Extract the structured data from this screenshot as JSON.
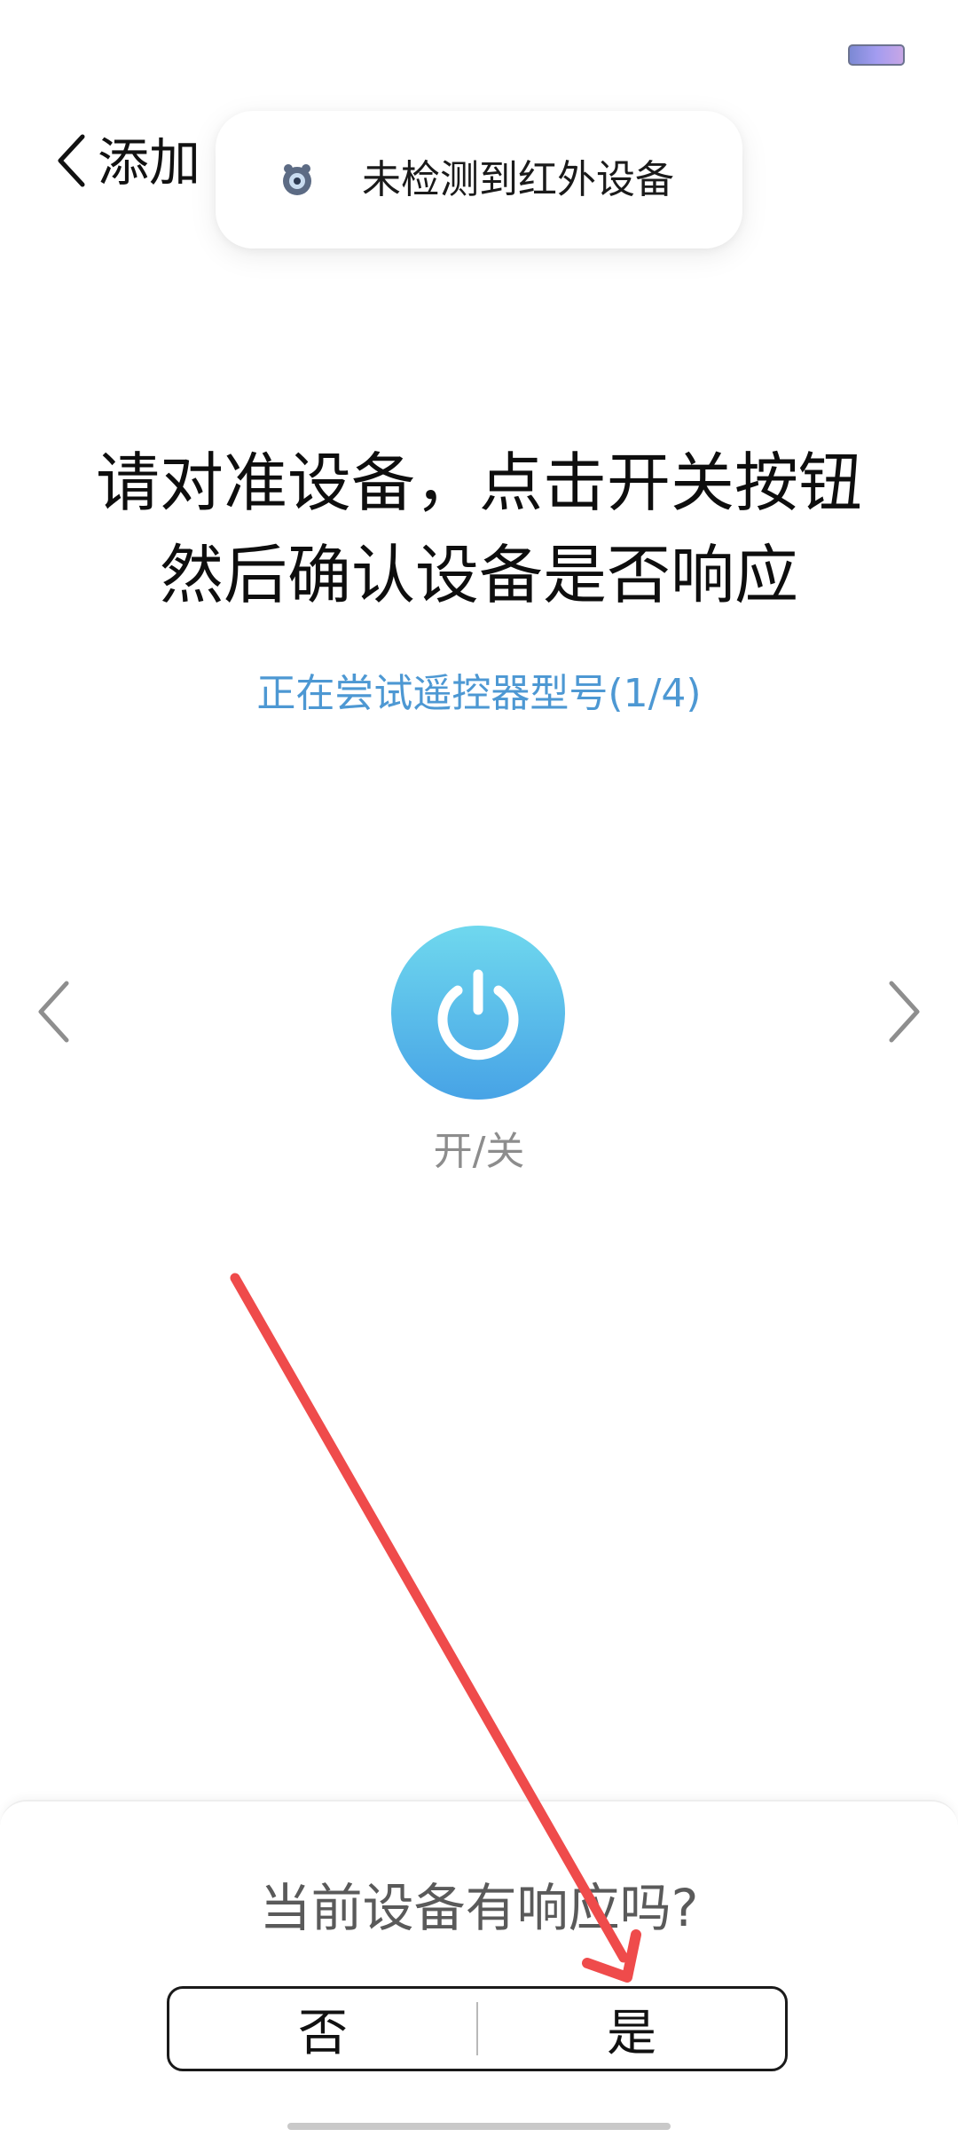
{
  "header": {
    "back_icon": "chevron-left-icon",
    "title": "添加"
  },
  "toast": {
    "icon": "infrared-icon",
    "message": "未检测到红外设备"
  },
  "instruction": {
    "line1": "请对准设备，点击开关按钮",
    "line2": "然后确认设备是否响应"
  },
  "model_status": "正在尝试遥控器型号(1/4)",
  "power": {
    "icon": "power-icon",
    "label": "开/关",
    "gradient_top": "#6fd8ee",
    "gradient_bottom": "#47a3e6"
  },
  "navigation": {
    "prev_icon": "chevron-left-icon",
    "next_icon": "chevron-right-icon"
  },
  "bottom_sheet": {
    "question": "当前设备有响应吗?",
    "no_label": "否",
    "yes_label": "是"
  },
  "annotation": {
    "color": "#ef4b4b"
  }
}
